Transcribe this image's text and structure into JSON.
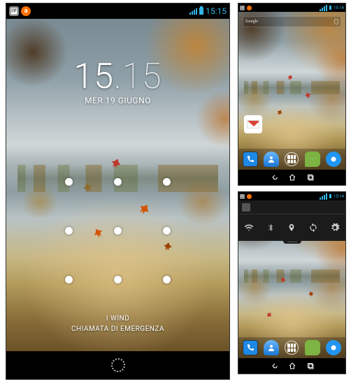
{
  "colors": {
    "accent": "#33b5e5"
  },
  "status": {
    "time": "15:15",
    "notif_gallery_bg": "#ff9800",
    "notif_gallery_fg": "#fff",
    "notif_gallery_glyph": "▣",
    "small_time": "15:14"
  },
  "lock": {
    "hours": "15",
    "minutes": "15",
    "separator": ".",
    "date": "MER 19 GIUGNO",
    "carrier": "I WIND",
    "emergency": "CHIAMATA DI EMERGENZA"
  },
  "home": {
    "search_brand": "Google",
    "gmail_label": "Gmail",
    "dock": {
      "phone": "Phone",
      "contacts": "Contacts",
      "apps": "Apps",
      "messaging": "Messaging",
      "browser": "Browser"
    }
  },
  "qs": {
    "owner": "",
    "toggles": [
      {
        "name": "wifi"
      },
      {
        "name": "bluetooth"
      },
      {
        "name": "location"
      },
      {
        "name": "sync"
      },
      {
        "name": "settings"
      }
    ]
  },
  "nav": {
    "back": "Back",
    "home": "Home",
    "recent": "Recent apps"
  }
}
